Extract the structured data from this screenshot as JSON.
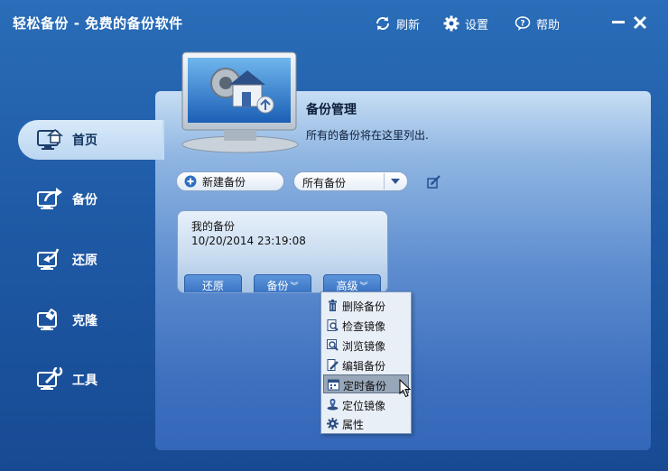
{
  "window": {
    "title": "轻松备份 - 免费的备份软件",
    "toolbar": {
      "refresh_label": "刷新",
      "settings_label": "设置",
      "help_label": "帮助"
    }
  },
  "sidebar": {
    "items": [
      {
        "label": "首页",
        "icon": "home-monitor-icon",
        "active": true
      },
      {
        "label": "备份",
        "icon": "backup-monitor-icon"
      },
      {
        "label": "还原",
        "icon": "restore-monitor-icon"
      },
      {
        "label": "克隆",
        "icon": "clone-monitor-icon"
      },
      {
        "label": "工具",
        "icon": "tools-monitor-icon"
      }
    ]
  },
  "main": {
    "title": "备份管理",
    "subtitle": "所有的备份将在这里列出.",
    "new_backup_label": "新建备份",
    "filter": {
      "selected": "所有备份"
    },
    "backup_card": {
      "name": "我的备份",
      "date": "10/20/2014 23:19:08",
      "buttons": {
        "restore": "还原",
        "backup": "备份",
        "advanced": "高级"
      }
    },
    "advanced_menu": {
      "items": [
        {
          "label": "删除备份",
          "icon": "trash-icon"
        },
        {
          "label": "检查镜像",
          "icon": "check-image-icon"
        },
        {
          "label": "浏览镜像",
          "icon": "browse-image-icon"
        },
        {
          "label": "编辑备份",
          "icon": "edit-backup-icon"
        },
        {
          "label": "定时备份",
          "icon": "schedule-icon",
          "highlighted": true
        },
        {
          "label": "定位镜像",
          "icon": "locate-image-icon"
        },
        {
          "label": "属性",
          "icon": "properties-gear-icon"
        }
      ]
    }
  },
  "colors": {
    "window_bg": "#1f5aa6",
    "panel_light": "#c7def4",
    "panel_dark": "#3467b8",
    "button_blue": "#3570c1",
    "menu_bg": "#e9eff7",
    "menu_highlight": "#97a6b8"
  }
}
